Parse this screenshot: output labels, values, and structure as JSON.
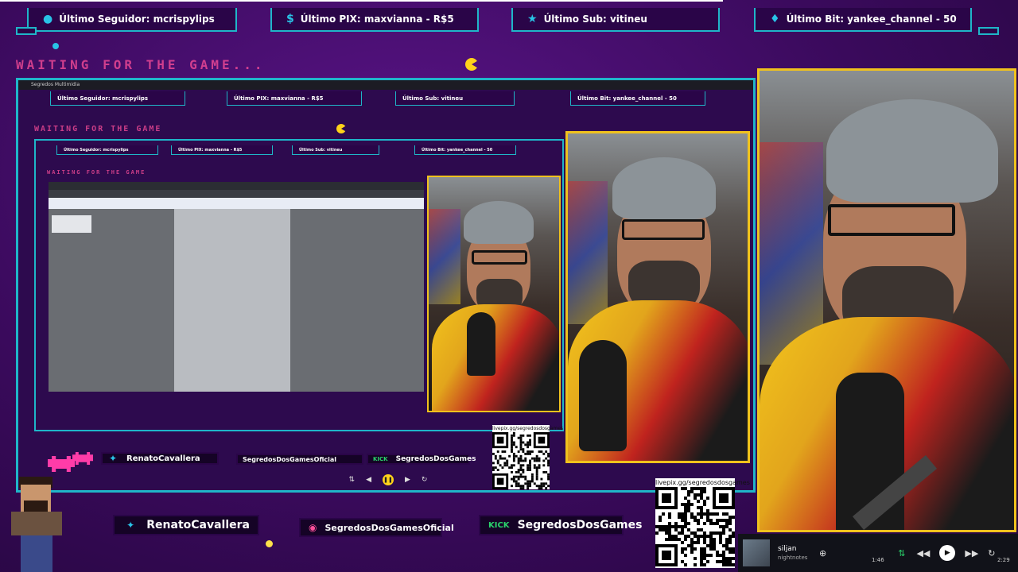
{
  "alerts": {
    "follower": "Último Seguidor: mcrispylips",
    "pix": "Último PIX: maxvianna - R$5",
    "sub": "Último Sub: vitineu",
    "bit": "Último Bit: yankee_channel - 50"
  },
  "waiting_text": "WAITING FOR THE GAME...",
  "waiting_text_mini": "WAITING FOR THE GAME",
  "window_title": "Segredos Multimidia",
  "social": {
    "twitter": "RenatoCavallera",
    "instagram": "SegredosDosGamesOficial",
    "kick_icon": "KICK",
    "kick": "SegredosDosGames"
  },
  "qr": {
    "label": "livepix.gg/segredosdosgames"
  },
  "music": {
    "title": "siljan",
    "artist": "nightnotes",
    "elapsed": "1:46",
    "duration": "2:29",
    "progress": 0.71
  },
  "colors": {
    "accent": "#1fb6c9",
    "frame": "#f0c21d",
    "background": "#3a0a5c",
    "waiting": "#ff4f9a"
  },
  "icons": {
    "follower": "user-icon",
    "pix": "dollar-icon",
    "sub": "star-icon",
    "bit": "diamond-icon",
    "twitter": "twitter-icon",
    "instagram": "instagram-icon"
  }
}
